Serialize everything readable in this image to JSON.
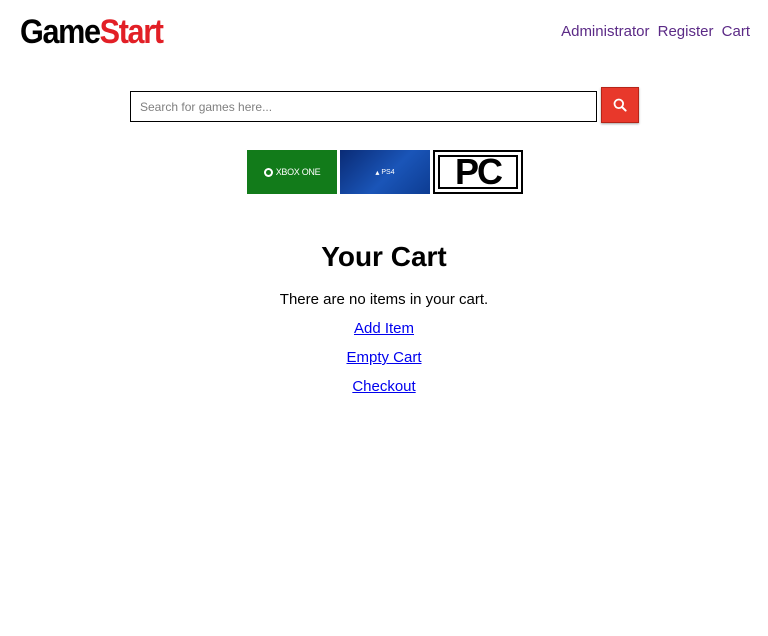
{
  "header": {
    "logo": {
      "part1": "Game",
      "part2": "Start"
    },
    "nav": [
      {
        "label": "Administrator"
      },
      {
        "label": "Register"
      },
      {
        "label": "Cart"
      }
    ]
  },
  "search": {
    "placeholder": "Search for games here...",
    "value": "",
    "button_icon": "search-icon",
    "button_color": "#e8382b"
  },
  "platforms": [
    {
      "label": "XBOX ONE",
      "color": "#127b1a"
    },
    {
      "label": "PS4",
      "color": "#1a55b8"
    },
    {
      "label": "PC",
      "color": "#000000"
    }
  ],
  "cart": {
    "title": "Your Cart",
    "empty_message": "There are no items in your cart.",
    "links": [
      {
        "label": "Add Item"
      },
      {
        "label": "Empty Cart"
      },
      {
        "label": "Checkout"
      }
    ]
  },
  "colors": {
    "logo_accent": "#e21f26",
    "nav_link": "#5b2a86",
    "body_link": "#0000ee"
  }
}
